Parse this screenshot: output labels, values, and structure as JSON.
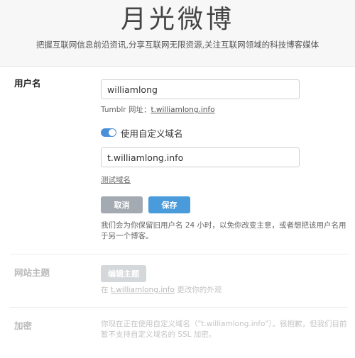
{
  "header": {
    "title": "月光微博",
    "subtitle": "把握互联网信息前沿资讯,分享互联网无限资源,关注互联网领域的科技博客媒体"
  },
  "username_section": {
    "label": "用户名",
    "username_value": "williamlong",
    "tumblr_prefix": "Tumblr 网址：",
    "tumblr_link": "t.williamlong.info",
    "toggle_label": "使用自定义域名",
    "toggle_on": true,
    "domain_value": "t.williamlong.info",
    "test_domain_link": "测试域名",
    "cancel_label": "取消",
    "save_label": "保存",
    "notice": "我们会为你保留旧用户名 24 小时，以免你改变主意，或者想把该用户名用于另一个博客。"
  },
  "theme_section": {
    "label": "网站主题",
    "edit_label": "编辑主题",
    "helper_prefix": "在 ",
    "helper_link": "t.williamlong.info",
    "helper_suffix": " 更改你的外观"
  },
  "encrypt_section": {
    "label": "加密",
    "text": "你现在正在使用自定义域名（\"t.williamlong.info\"）。很抱歉，但我们目前暂不支持自定义域名的 SSL 加密。"
  },
  "colors": {
    "accent": "#4a9bdb",
    "toggle": "#4a90d9",
    "cancel": "#a3aab1"
  }
}
